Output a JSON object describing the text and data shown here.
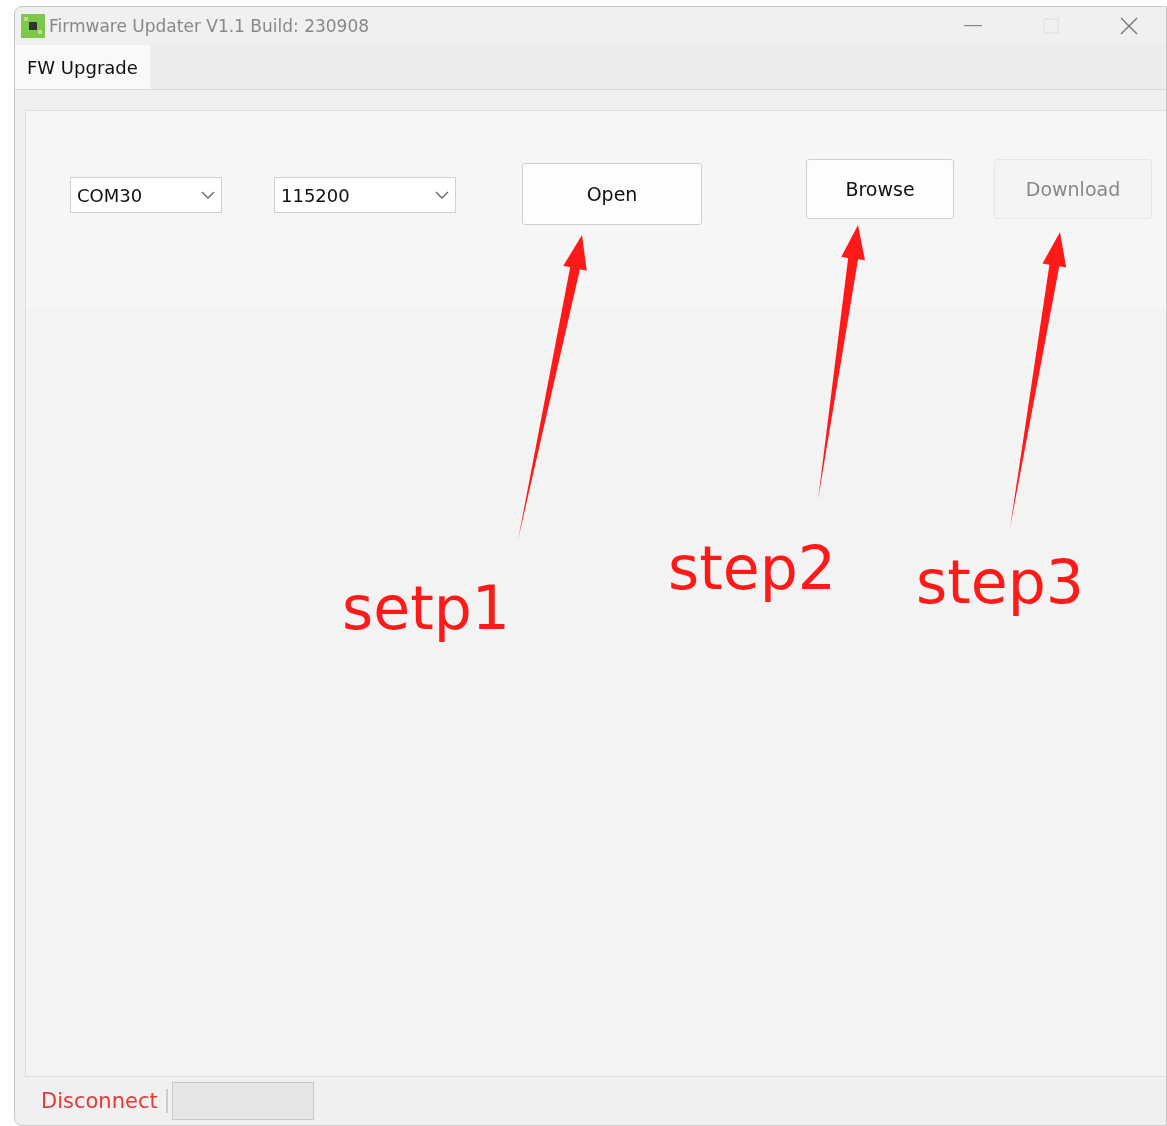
{
  "window": {
    "title": "Firmware Updater V1.1 Build: 230908"
  },
  "tabs": [
    {
      "label": "FW Upgrade",
      "selected": true
    }
  ],
  "toolbar": {
    "port": "COM30",
    "baud": "115200",
    "buttons": [
      {
        "label": "Open",
        "disabled": false
      },
      {
        "label": "Browse",
        "disabled": false
      },
      {
        "label": "Download",
        "disabled": true
      }
    ]
  },
  "annotations": [
    {
      "label": "setp1"
    },
    {
      "label": "step2"
    },
    {
      "label": "step3"
    }
  ],
  "status_bar": {
    "connection": "Disconnect"
  }
}
